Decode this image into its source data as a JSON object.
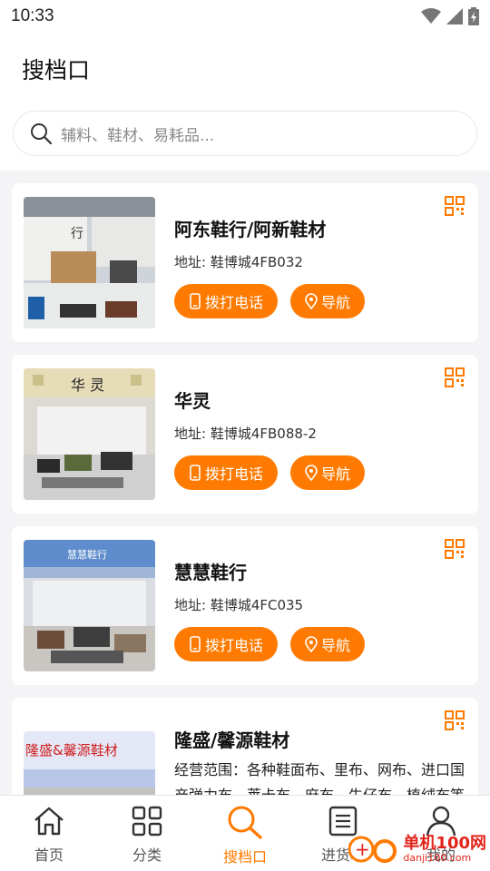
{
  "status": {
    "time": "10:33"
  },
  "header": {
    "title": "搜档口"
  },
  "search": {
    "placeholder": "辅料、鞋材、易耗品..."
  },
  "shops": [
    {
      "name": "阿东鞋行/阿新鞋材",
      "address": "地址: 鞋博城4FB032",
      "call_label": "拨打电话",
      "nav_label": "导航",
      "photo_sign": "行"
    },
    {
      "name": "华灵",
      "address": "地址: 鞋博城4FB088-2",
      "call_label": "拨打电话",
      "nav_label": "导航",
      "photo_sign": "华 灵"
    },
    {
      "name": "慧慧鞋行",
      "address": "地址: 鞋博城4FC035",
      "call_label": "拨打电话",
      "nav_label": "导航",
      "photo_sign": "慧慧鞋行"
    },
    {
      "name": "隆盛/馨源鞋材",
      "scope": "经营范围：各种鞋面布、里布、网布、进口国产弹力布、莱卡布、麻布、牛仔布、植绒布等",
      "photo_sign": "隆盛&馨源鞋材"
    }
  ],
  "tabs": [
    {
      "label": "首页",
      "icon": "home-icon"
    },
    {
      "label": "分类",
      "icon": "grid-icon"
    },
    {
      "label": "搜档口",
      "icon": "search-icon",
      "active": true
    },
    {
      "label": "进货单",
      "icon": "list-icon"
    },
    {
      "label": "我的",
      "icon": "user-icon"
    }
  ],
  "watermark": {
    "text": "单机100网",
    "sub": "danji100.com"
  },
  "colors": {
    "accent": "#ff7a00",
    "background": "#f4f4f6"
  }
}
